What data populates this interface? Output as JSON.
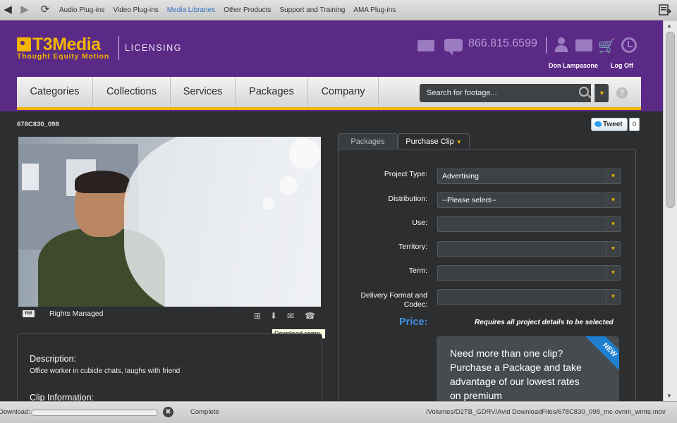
{
  "host_toolbar": {
    "links": [
      "Audio Plug-ins",
      "Video Plug-ins",
      "Media Libraries",
      "Other Products",
      "Support and Training",
      "AMA Plug-ins"
    ],
    "active_link": "Media Libraries"
  },
  "header": {
    "logo_text": "T3Media",
    "logo_subtext": "Thought Equity Motion",
    "section": "LICENSING",
    "phone": "866.815.6599",
    "user_name": "Don Lampasone",
    "logoff_label": "Log Off"
  },
  "nav": {
    "items": [
      "Categories",
      "Collections",
      "Services",
      "Packages",
      "Company"
    ],
    "search_placeholder": "Search for footage..."
  },
  "clip": {
    "id": "678C830_098",
    "tweet_label": "Tweet",
    "tweet_count": "0",
    "rights_badge": "RM",
    "rights_label": "Rights Managed",
    "tooltip": "Download comp",
    "description_title": "Description:",
    "description": "Office worker in cubicle chats, laughs with friend",
    "clip_info_title": "Clip Information:"
  },
  "purchase": {
    "tabs": [
      "Packages",
      "Purchase Clip"
    ],
    "active_tab": "Purchase Clip",
    "fields": [
      {
        "label": "Project Type:",
        "value": "Advertising"
      },
      {
        "label": "Distribution:",
        "value": "--Please select--"
      },
      {
        "label": "Use:",
        "value": ""
      },
      {
        "label": "Territory:",
        "value": ""
      },
      {
        "label": "Term:",
        "value": ""
      },
      {
        "label": "Delivery Format and Codec:",
        "value": ""
      }
    ],
    "price_label": "Price:",
    "price_note": "Requires all project details to be selected",
    "promo_text": "Need more than one clip? Purchase a Package and take advantage of our lowest rates on premium",
    "promo_badge": "NEW"
  },
  "download_bar": {
    "label": "Download:",
    "progress": 0,
    "status": "Complete",
    "path": "/Volumes/D2TB_GDRV/Avid DownloadFiles/678C830_098_mc-ovnm_wmte.mov"
  },
  "colors": {
    "brand_purple": "#5a2a86",
    "accent_gold": "#f2b400",
    "price_blue": "#3f8fe0"
  },
  "icons": {
    "back": "arrow-left-icon",
    "forward": "arrow-right-icon",
    "reload": "reload-icon",
    "mail": "mail-icon",
    "chat": "chat-icon",
    "account": "user-icon",
    "folder": "folder-icon",
    "cart": "cart-icon",
    "history": "clock-icon",
    "search": "search-icon",
    "help": "help-icon",
    "add": "plus-icon",
    "download": "download-icon",
    "email": "envelope-icon",
    "phone": "phone-icon"
  }
}
